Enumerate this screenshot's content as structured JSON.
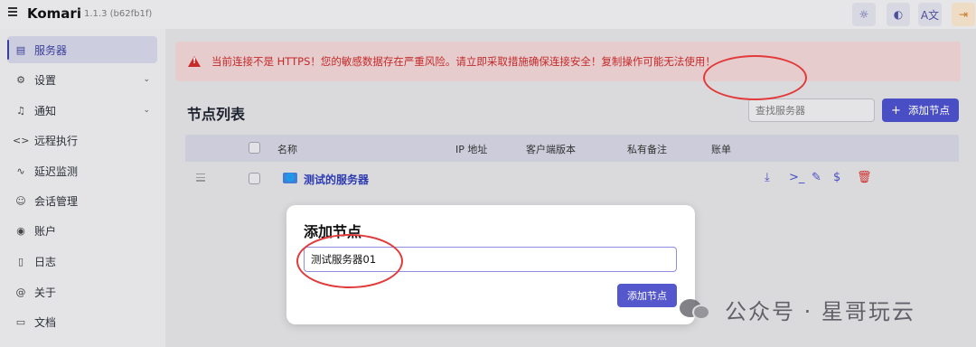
{
  "app": {
    "title": "Komari",
    "version": "1.1.3 (b62fb1f)"
  },
  "toolbar": {
    "brightness_icon": "sun-icon",
    "theme_icon": "palette-icon",
    "language_icon": "translate-icon",
    "logout_icon": "logout-icon"
  },
  "sidebar": {
    "items": [
      {
        "label": "服务器",
        "icon": "server-icon",
        "active": true
      },
      {
        "label": "设置",
        "icon": "settings-icon",
        "expandable": true
      },
      {
        "label": "通知",
        "icon": "bell-icon",
        "expandable": true
      },
      {
        "label": "远程执行",
        "icon": "code-icon"
      },
      {
        "label": "延迟监测",
        "icon": "pulse-icon"
      },
      {
        "label": "会话管理",
        "icon": "users-icon"
      },
      {
        "label": "账户",
        "icon": "account-icon"
      },
      {
        "label": "日志",
        "icon": "log-icon"
      },
      {
        "label": "关于",
        "icon": "at-icon"
      },
      {
        "label": "文档",
        "icon": "book-icon"
      }
    ]
  },
  "warning": {
    "text": "当前连接不是 HTTPS！您的敏感数据存在严重风险。请立即采取措施确保连接安全！复制操作可能无法使用！"
  },
  "nodes": {
    "title": "节点列表",
    "search_placeholder": "查找服务器",
    "add_button": "添加节点",
    "columns": [
      "名称",
      "IP 地址",
      "客户端版本",
      "私有备注",
      "账单"
    ],
    "rows": [
      {
        "name": "测试的服务器"
      }
    ]
  },
  "modal": {
    "title": "添加节点",
    "input_value": "测试服务器01",
    "submit_label": "添加节点"
  },
  "watermark": {
    "text": "公众号 · 星哥玩云"
  },
  "colors": {
    "accent": "#4a4ec4",
    "danger": "#c62a2a",
    "annotation": "#e23a3a"
  }
}
